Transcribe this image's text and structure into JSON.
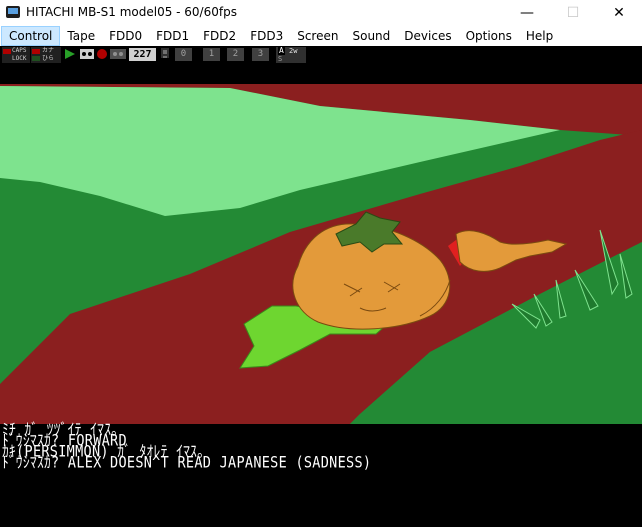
{
  "window": {
    "title": "HITACHI MB-S1 model05 - 60/60fps",
    "minimize_glyph": "—",
    "maximize_glyph": "☐",
    "close_glyph": "✕"
  },
  "menu": [
    {
      "label": "Control",
      "active": true
    },
    {
      "label": "Tape"
    },
    {
      "label": "FDD0"
    },
    {
      "label": "FDD1"
    },
    {
      "label": "FDD2"
    },
    {
      "label": "FDD3"
    },
    {
      "label": "Screen"
    },
    {
      "label": "Sound"
    },
    {
      "label": "Devices"
    },
    {
      "label": "Options"
    },
    {
      "label": "Help"
    }
  ],
  "status": {
    "caps_label": "CAPS",
    "lock_label": "LOCK",
    "kana_label": "カナ",
    "hira_label": "ひら",
    "tape_counter": "227",
    "fdd_labels": [
      "0",
      "1",
      "2",
      "3"
    ],
    "mode_a": "A",
    "mode_2w": "2w",
    "mode_s": "S"
  },
  "console": {
    "lines": [
      "ﾐﾁ ｶﾞ ﾂﾂﾞｲﾃ ｲﾏｽ｡",
      "ﾄﾞｳｼﾏｽｶ? FORWARD",
      "ｶｷ(PERSIMMON) ｶﾞ ﾀｵﾚﾃ ｲﾏｽ｡",
      "ﾄﾞｳｼﾏｽｶ? ALEX DOESN^T READ JAPANESE (SADNESS)"
    ]
  },
  "colors": {
    "dark_green": "#238a35",
    "light_green": "#7ee38e",
    "road_red": "#8b1f1f",
    "persimmon": "#e39a3a",
    "leaf": "#6ed630",
    "text": "#ffffff"
  }
}
